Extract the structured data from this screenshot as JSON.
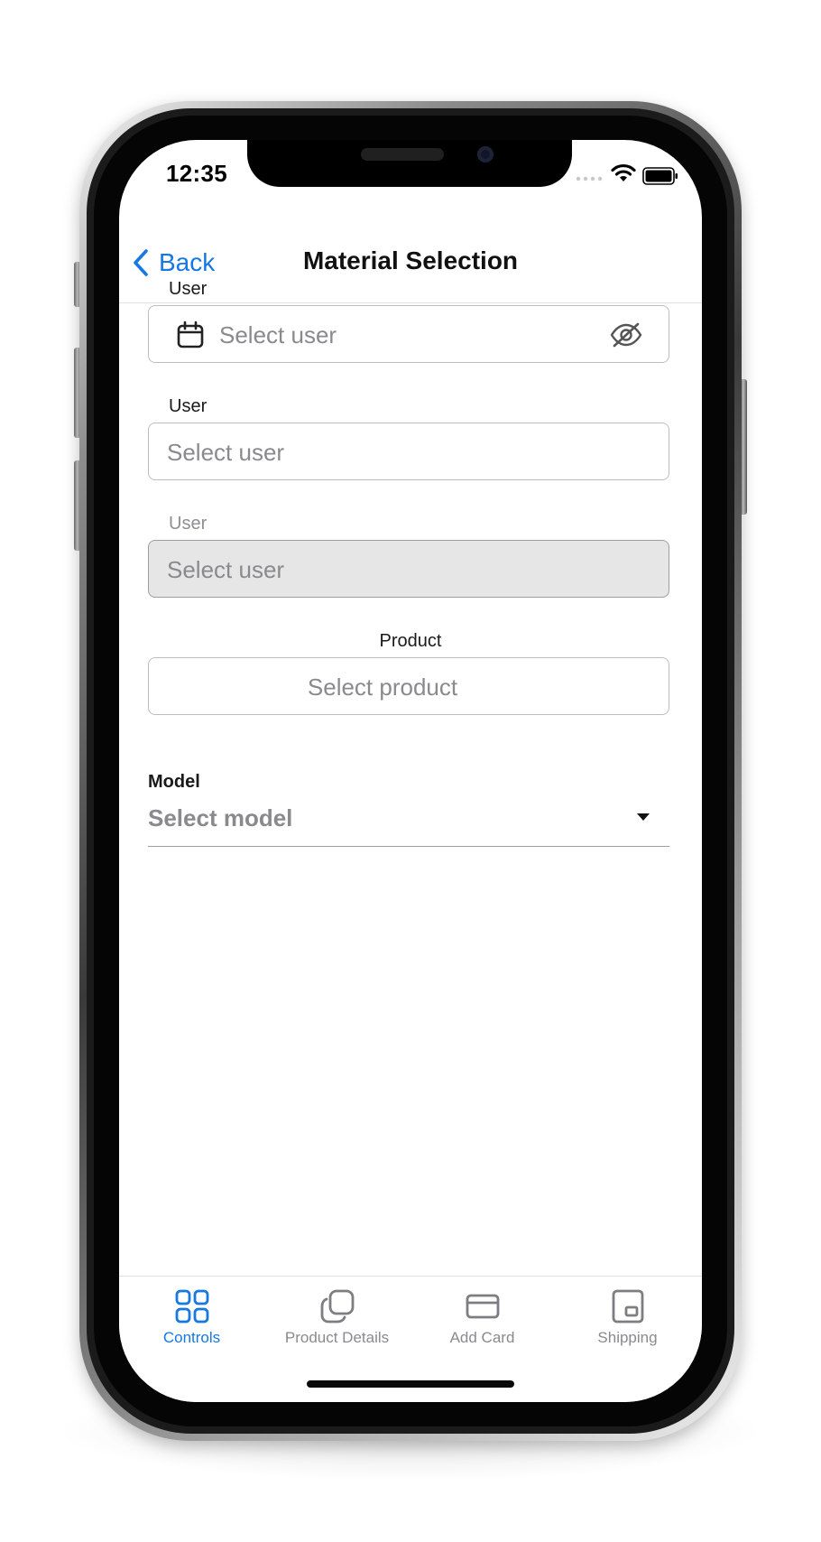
{
  "status_bar": {
    "time": "12:35"
  },
  "nav": {
    "back_label": "Back",
    "title": "Material Selection"
  },
  "form": {
    "user_field_1": {
      "label": "User",
      "placeholder": "Select user",
      "left_icon": "calendar-icon",
      "right_icon": "eye-off-icon"
    },
    "user_field_2": {
      "label": "User",
      "placeholder": "Select user"
    },
    "user_field_3": {
      "label": "User",
      "placeholder": "Select user",
      "disabled": true
    },
    "product_field": {
      "label": "Product",
      "placeholder": "Select product"
    },
    "model_field": {
      "label": "Model",
      "placeholder": "Select model",
      "icon": "caret-down-icon"
    }
  },
  "tabs": [
    {
      "label": "Controls",
      "icon": "grid-icon",
      "active": true
    },
    {
      "label": "Product Details",
      "icon": "copy-icon",
      "active": false
    },
    {
      "label": "Add Card",
      "icon": "card-icon",
      "active": false
    },
    {
      "label": "Shipping",
      "icon": "shipping-icon",
      "active": false
    }
  ],
  "colors": {
    "accent": "#1678e3",
    "placeholder": "#8a8a8e",
    "border": "#bdbdbd",
    "disabled_bg": "#e6e6e6",
    "tab_inactive": "#8a8a8e"
  }
}
